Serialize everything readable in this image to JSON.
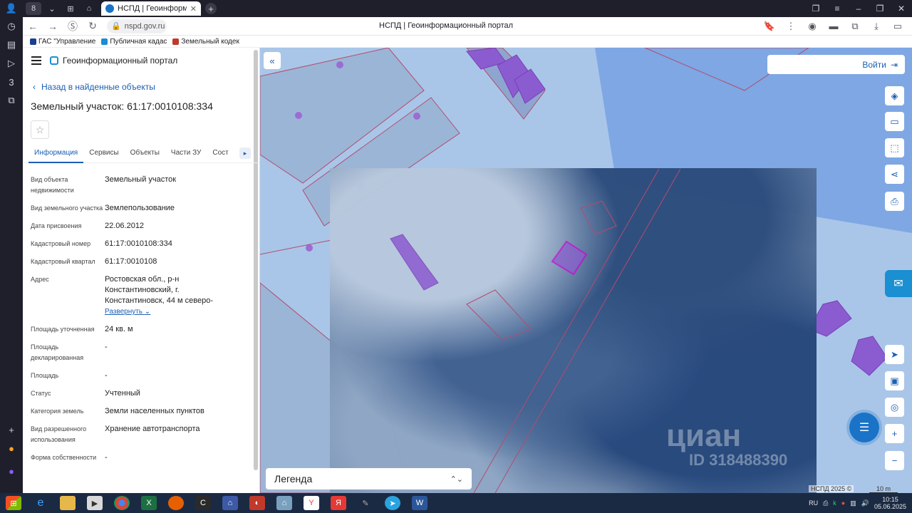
{
  "browser": {
    "tab_title": "НСПД | Геоинформационный",
    "url": "nspd.gov.ru",
    "page_title": "НСПД | Геоинформационный портал",
    "bookmarks": [
      "ГАС \"Управление",
      "Публичная кадас",
      "Земельный кодек"
    ],
    "accent": "#1a73c7"
  },
  "panel": {
    "portal_name": "Геоинформационный портал",
    "back_label": "Назад в найденные объекты",
    "title": "Земельный участок: 61:17:0010108:334",
    "tabs": [
      "Информация",
      "Сервисы",
      "Объекты",
      "Части ЗУ",
      "Сост"
    ],
    "active_tab": "Информация",
    "properties": [
      {
        "key": "Вид объекта недвижимости",
        "value": "Земельный участок"
      },
      {
        "key": "Вид земельного участка",
        "value": "Землепользование"
      },
      {
        "key": "Дата присвоения",
        "value": "22.06.2012"
      },
      {
        "key": "Кадастровый номер",
        "value": "61:17:0010108:334"
      },
      {
        "key": "Кадастровый квартал",
        "value": "61:17:0010108"
      },
      {
        "key": "Адрес",
        "value": "Ростовская обл., р-н Константиновский, г. Константиновск, 44 м северо-",
        "link": "Развернуть"
      },
      {
        "key": "Площадь уточненная",
        "value": "24 кв. м"
      },
      {
        "key": "Площадь декларированная",
        "value": "-"
      },
      {
        "key": "Площадь",
        "value": "-"
      },
      {
        "key": "Статус",
        "value": "Учтенный"
      },
      {
        "key": "Категория земель",
        "value": "Земли населенных пунктов"
      },
      {
        "key": "Вид разрешенного использования",
        "value": "Хранение автотранспорта"
      },
      {
        "key": "Форма собственности",
        "value": "-"
      }
    ]
  },
  "map": {
    "login_label": "Войти",
    "legend_label": "Легенда",
    "watermark": "циан",
    "watermark_id": "ID 318488390",
    "copyright": "НСПД 2025 ©",
    "scale": "10 m",
    "tools": [
      "layers-icon",
      "ruler-icon",
      "select-area-icon",
      "share-icon",
      "print-icon"
    ],
    "nav_tools": [
      "locate-icon",
      "minimap-icon",
      "pin-icon",
      "zoom-in-icon",
      "zoom-out-icon"
    ]
  },
  "taskbar": {
    "lang": "RU",
    "time": "10:15",
    "date": "05.06.2025"
  }
}
